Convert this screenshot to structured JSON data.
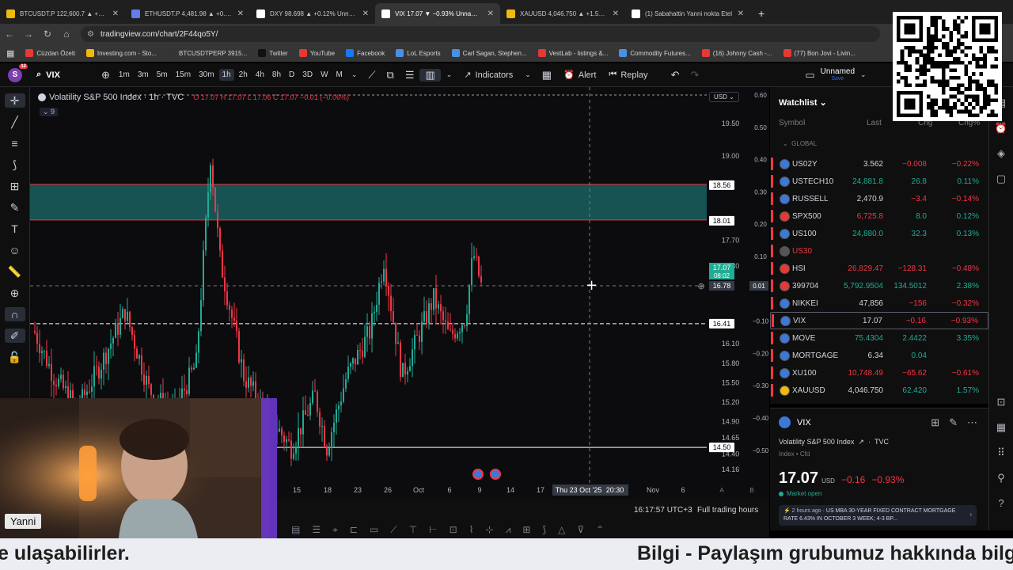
{
  "browser": {
    "tabs": [
      {
        "title": "BTCUSDT.P 122,600.7 ▲ +1.08%",
        "active": false
      },
      {
        "title": "ETHUSDT.P 4,481.98 ▲ +0.81%",
        "active": false
      },
      {
        "title": "DXY 98.698 ▲ +0.12% Unname",
        "active": false
      },
      {
        "title": "VIX 17.07 ▼ −0.93% Unnamed",
        "active": true
      },
      {
        "title": "XAUUSD 4,046.750 ▲ +1.57%",
        "active": false
      },
      {
        "title": "(1) Sabahattin Yanni nokta Etel",
        "active": false
      }
    ],
    "url": "tradingview.com/chart/2F44qo5Y/",
    "bookmarks": [
      "Cüzdan Özeti",
      "Investing.com - Sto...",
      "BTCUSDTPERP 3915...",
      "Twitter",
      "YouTube",
      "Facebook",
      "LoL Esports",
      "Carl Sagan, Stephen...",
      "VestLab - listings &...",
      "Commodity Futures...",
      "(16) Johnny Cash -...",
      "(77) Bon Jovi - Livin..."
    ]
  },
  "toolbar": {
    "avatar_letter": "S",
    "avatar_badge": "12",
    "symbol": "VIX",
    "intervals": [
      "1m",
      "3m",
      "5m",
      "15m",
      "30m",
      "1h",
      "2h",
      "4h",
      "8h",
      "D",
      "3D",
      "W",
      "M"
    ],
    "selected_interval": "1h",
    "indicators_label": "Indicators",
    "alert_label": "Alert",
    "replay_label": "Replay",
    "layout_name": "Unnamed",
    "layout_sub": "Save"
  },
  "chart": {
    "legend_title": "Volatility S&P 500 Index · 1h · TVC",
    "ohlc": "O 17.07 H 17.07 L 17.06 C 17.07 −0.01 (−0.06%)",
    "indicator_count": "9",
    "currency": "USD",
    "price_labels": [
      "19.50",
      "19.00",
      "17.70",
      "17.30",
      "16.10",
      "15.80",
      "15.50",
      "15.20",
      "14.90",
      "14.65",
      "14.40",
      "14.16"
    ],
    "right_scale": [
      "0.60",
      "0.50",
      "0.40",
      "0.30",
      "0.20",
      "0.10",
      "−0.10",
      "−0.20",
      "−0.30",
      "−0.40",
      "−0.50"
    ],
    "tag_high": "18.56",
    "tag_zone": "18.01",
    "tag_last": "17.07",
    "tag_countdown": "08:02",
    "tag_cross": "16.78",
    "tag_cross_right": "0.01",
    "tag_line": "16.41",
    "tag_low": "14.50",
    "x_labels": [
      "15",
      "18",
      "23",
      "26",
      "Oct",
      "6",
      "9",
      "14",
      "17",
      "Nov",
      "6"
    ],
    "cursor_date": "Thu 23 Oct '25",
    "cursor_time": "20:30",
    "x_badges": [
      "A",
      "B"
    ],
    "time_status": "16:17:57 UTC+3",
    "session": "Full trading hours"
  },
  "watchlist": {
    "title": "Watchlist",
    "columns": {
      "symbol": "Symbol",
      "last": "Last",
      "chg": "Chg",
      "chgp": "Chg%"
    },
    "group": "GLOBAL",
    "rows": [
      {
        "sym": "US02Y",
        "last": "3.562",
        "chg": "−0.008",
        "chgp": "−0.22%",
        "dir": "dn",
        "color": "#3c78d8"
      },
      {
        "sym": "USTECH10",
        "last": "24,881.8",
        "chg": "26.8",
        "chgp": "0.11%",
        "dir": "up",
        "color": "#3c78d8"
      },
      {
        "sym": "RUSSELL",
        "last": "2,470.9",
        "chg": "−3.4",
        "chgp": "−0.14%",
        "dir": "dn",
        "color": "#3c78d8"
      },
      {
        "sym": "SPX500",
        "last": "6,725.8",
        "chg": "8.0",
        "chgp": "0.12%",
        "dir": "up",
        "color": "#e53935"
      },
      {
        "sym": "US100",
        "last": "24,880.0",
        "chg": "32.3",
        "chgp": "0.13%",
        "dir": "up",
        "color": "#3c78d8"
      },
      {
        "sym": "US30",
        "last": "",
        "chg": "",
        "chgp": "",
        "dir": "dn",
        "color": "#555555"
      },
      {
        "sym": "HSI",
        "last": "26,829.47",
        "chg": "−128.31",
        "chgp": "−0.48%",
        "dir": "dn",
        "color": "#e53935"
      },
      {
        "sym": "399704",
        "last": "5,792.9504",
        "chg": "134.5012",
        "chgp": "2.38%",
        "dir": "up",
        "color": "#e53935"
      },
      {
        "sym": "NIKKEI",
        "last": "47,856",
        "chg": "−156",
        "chgp": "−0.32%",
        "dir": "dn",
        "color": "#3c78d8"
      },
      {
        "sym": "VIX",
        "last": "17.07",
        "chg": "−0.16",
        "chgp": "−0.93%",
        "dir": "dn",
        "color": "#3c78d8"
      },
      {
        "sym": "MOVE",
        "last": "75.4304",
        "chg": "2.4422",
        "chgp": "3.35%",
        "dir": "up",
        "color": "#3c78d8"
      },
      {
        "sym": "MORTGAGE",
        "last": "6.34",
        "chg": "0.04",
        "chgp": "",
        "dir": "up",
        "color": "#3c78d8"
      },
      {
        "sym": "XU100",
        "last": "10,748.49",
        "chg": "−65.62",
        "chgp": "−0.61%",
        "dir": "dn",
        "color": "#3c78d8"
      },
      {
        "sym": "XAUUSD",
        "last": "4,046.750",
        "chg": "62.420",
        "chgp": "1.57%",
        "dir": "up",
        "color": "#f0b90b"
      }
    ]
  },
  "details": {
    "symbol": "VIX",
    "name": "Volatility S&P 500 Index",
    "exchange": "TVC",
    "meta": "Index • Cfd",
    "price": "17.07",
    "currency": "USD",
    "change": "−0.16",
    "change_pct": "−0.93%",
    "market_status": "Market open",
    "news_time": "2 hours ago",
    "news_text": "US MBA 30-YEAR FIXED CONTRACT MORTGAGE RATE 6.43% IN OCTOBER 3 WEEK; 4-3 BP..."
  },
  "stream": {
    "host_name": "Yanni",
    "ticker_left": "e ulaşabilirler.",
    "ticker_right": "Bilgi - Paylaşım grubumuz hakkında bilg"
  },
  "colors": {
    "up": "#22ab94",
    "down": "#f23645",
    "zone": "#1b6b6b"
  }
}
